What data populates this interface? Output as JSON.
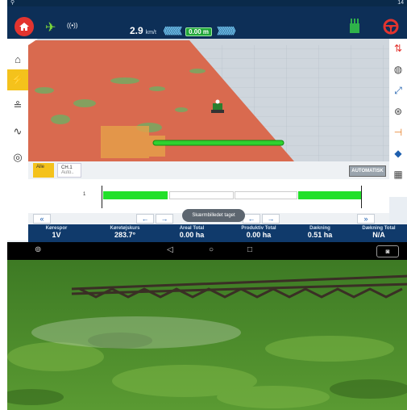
{
  "statusbar": {
    "time": "14"
  },
  "toolbar": {
    "speed_value": "2.9",
    "speed_unit": "km/t",
    "off_track": "0.00 m",
    "chev_left": "《《《《《《",
    "chev_right": "》》》》》》"
  },
  "sections_panel": {
    "tab_all": "Alle",
    "tab_ch_title": "CH.1",
    "tab_ch_sub": "Auto..",
    "mode_button": "AUTOMATISK",
    "row_number": "1"
  },
  "toast": "Skærmbilledet taget",
  "stats": [
    {
      "label": "Kørespor",
      "value": "1V"
    },
    {
      "label": "Køretøjskurs",
      "value": "283.7°"
    },
    {
      "label": "Areal Total",
      "value": "0.00 ha"
    },
    {
      "label": "Produktiv Total",
      "value": "0.00 ha"
    },
    {
      "label": "Dækning",
      "value": "0.51 ha"
    },
    {
      "label": "Dækning Total",
      "value": "N/A"
    }
  ],
  "colors": {
    "toolbar": "#0d2f57",
    "accent": "#f4c21c",
    "coverage": "#d96a4f",
    "section_on": "#22e02a"
  }
}
